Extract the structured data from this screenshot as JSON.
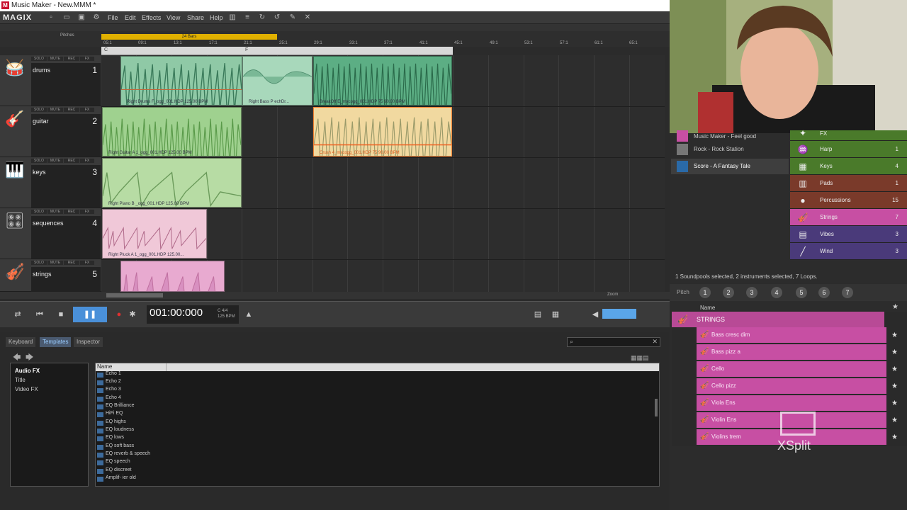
{
  "window": {
    "title": "Music Maker - New.MMM *",
    "app_icon": "M"
  },
  "menu": {
    "logo": "MAGIX",
    "items": [
      "File",
      "Edit",
      "Effects",
      "View",
      "Share",
      "Help"
    ]
  },
  "ruler": {
    "range_label": "24 Bars",
    "ticks": [
      "05:1",
      "09:1",
      "13:1",
      "17:1",
      "21:1",
      "25:1",
      "29:1",
      "33:1",
      "37:1",
      "41:1",
      "45:1",
      "49:1",
      "53:1",
      "57:1",
      "61:1",
      "65:1"
    ],
    "pitches_label": "Pitches"
  },
  "scenes": [
    "C",
    "F"
  ],
  "tracks": [
    {
      "name": "drums",
      "number": "1",
      "icon": "drums-icon",
      "glyph": "🥁"
    },
    {
      "name": "guitar",
      "number": "2",
      "icon": "guitar-icon",
      "glyph": "🎸"
    },
    {
      "name": "keys",
      "number": "3",
      "icon": "keys-icon",
      "glyph": "🎹"
    },
    {
      "name": "sequences",
      "number": "4",
      "icon": "sequencer-icon",
      "glyph": "🎛"
    },
    {
      "name": "strings",
      "number": "5",
      "icon": "violin-icon",
      "glyph": "🎻"
    }
  ],
  "track_buttons": [
    "SOLO",
    "MUTE",
    "REC",
    "FX"
  ],
  "clips": [
    {
      "label": "Right Drums F_ogg_001.HDP  125.00 BPM",
      "color": "#8fc9a6"
    },
    {
      "label": "Right Bass P echDr...",
      "color": "#a8d8bb"
    },
    {
      "label": "BreakOff E_mxcogg_001.HDP  75  90.00 BPM",
      "color": "#5cae84"
    },
    {
      "label": "Right Guitar A 1_ogg_001.HDP  125.00 BPM",
      "color": "#9fd18f"
    },
    {
      "label": "Crush 4_mxcogg_001.HDP  75  90.00 BPM",
      "color": "#f1d9a0"
    },
    {
      "label": "Right Piano B _ogg_001.HDP  125.00 BPM",
      "color": "#b7dca4"
    },
    {
      "label": "Right Pluck A 1_ogg_001.HDP  125.00...",
      "color": "#f0c8d8"
    },
    {
      "label": "",
      "color": "#e8aad0"
    }
  ],
  "transport": {
    "time": "001:00:000",
    "time_sig": "4/4",
    "tempo": "125 BPM",
    "key": "C",
    "zoom_label": "Zoom"
  },
  "bottom": {
    "tabs": [
      "Keyboard",
      "Templates",
      "Inspector"
    ],
    "active_tab": "Templates",
    "tree": [
      "Audio FX",
      "Title",
      "Video FX"
    ],
    "list_header": "Name",
    "files": [
      "Echo 1",
      "Echo 2",
      "Echo 3",
      "Echo 4",
      "EQ Brilliance",
      "HiFi EQ",
      "EQ highs",
      "EQ loudness",
      "EQ lows",
      "EQ soft bass",
      "EQ reverb & speech",
      "EQ speech",
      "EQ discreet",
      "Amplif- ier old"
    ]
  },
  "soundpools": [
    {
      "name": "Music Maker - Feel good"
    },
    {
      "name": "Rock - Rock Station"
    },
    {
      "name": "Score - A Fantasy Tale"
    }
  ],
  "instruments": [
    {
      "name": "FX",
      "count": "",
      "color": "#4a7a2a",
      "glyph": "✦"
    },
    {
      "name": "Harp",
      "count": "1",
      "color": "#4a7a2a",
      "glyph": "♒"
    },
    {
      "name": "Keys",
      "count": "4",
      "color": "#4a7a2a",
      "glyph": "▦"
    },
    {
      "name": "Pads",
      "count": "1",
      "color": "#7a3a2a",
      "glyph": "▥"
    },
    {
      "name": "Percussions",
      "count": "15",
      "color": "#7a3a2a",
      "glyph": "●"
    },
    {
      "name": "Strings",
      "count": "7",
      "color": "#c74fa3",
      "glyph": "🎻"
    },
    {
      "name": "Vibes",
      "count": "3",
      "color": "#4a3a7a",
      "glyph": "▤"
    },
    {
      "name": "Wind",
      "count": "3",
      "color": "#4a3a7a",
      "glyph": "╱"
    }
  ],
  "status": "1 Soundpools selected, 2 instruments selected, 7 Loops.",
  "pitch": {
    "label": "Pitch",
    "values": [
      "1",
      "2",
      "3",
      "4",
      "5",
      "6",
      "7"
    ]
  },
  "loops": {
    "header": "Name",
    "category": "STRINGS",
    "items": [
      "Bass cresc dim",
      "Bass pizz a",
      "Cello",
      "Cello pizz",
      "Viola Ens",
      "Violin Ens",
      "Violins trem"
    ]
  },
  "watermark": "XSplit"
}
